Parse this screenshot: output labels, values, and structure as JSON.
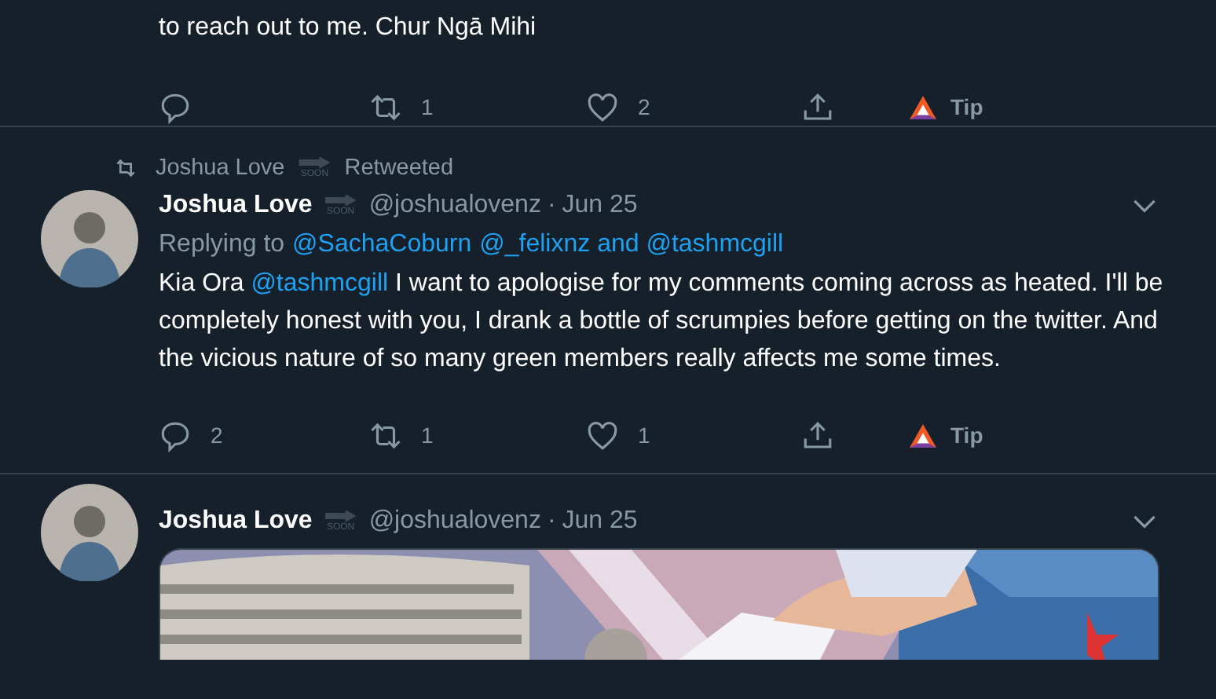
{
  "tweets": [
    {
      "body": {
        "before": "to reach out to me. Chur Ngā Mihi"
      },
      "actions": [
        {
          "kind": "reply"
        },
        {
          "kind": "retweet",
          "count": "1"
        },
        {
          "kind": "like",
          "count": "2"
        },
        {
          "kind": "share"
        },
        {
          "kind": "tip",
          "label": "Tip"
        }
      ]
    },
    {
      "context": {
        "name": "Joshua Love",
        "badge": "SOON",
        "label": "Retweeted"
      },
      "author": {
        "name": "Joshua Love",
        "badge": "SOON",
        "handle": "@joshualovenz",
        "separator": "·",
        "date": "Jun 25"
      },
      "replying": {
        "label": "Replying to",
        "links": [
          "@SachaCoburn",
          "@_felixnz and @tashmcgill"
        ]
      },
      "body": {
        "before": "Kia Ora ",
        "mention": "@tashmcgill",
        "after": " I want to apologise for my comments coming across as heated. I'll be completely honest with you, I drank a bottle of scrumpies before getting on the twitter. And the vicious nature of so many green members really affects me some times."
      },
      "actions": [
        {
          "kind": "reply",
          "count": "2"
        },
        {
          "kind": "retweet",
          "count": "1"
        },
        {
          "kind": "like",
          "count": "1"
        },
        {
          "kind": "share"
        },
        {
          "kind": "tip",
          "label": "Tip"
        }
      ]
    },
    {
      "author": {
        "name": "Joshua Love",
        "badge": "SOON",
        "handle": "@joshualovenz",
        "separator": "·",
        "date": "Jun 25"
      }
    }
  ]
}
